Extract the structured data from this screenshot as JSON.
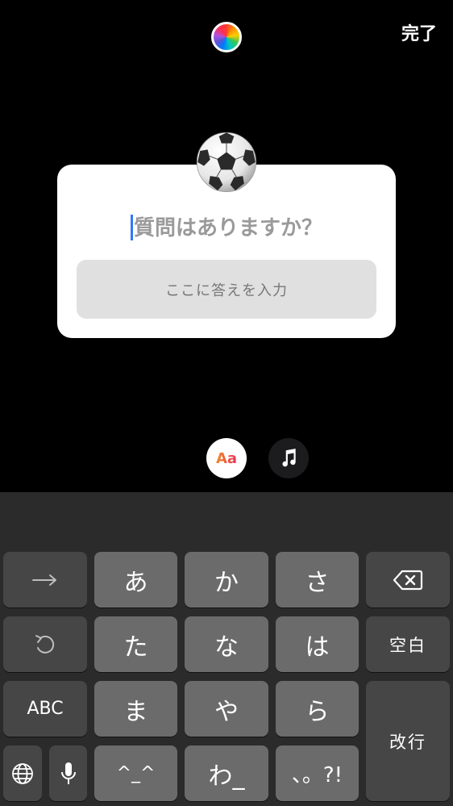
{
  "top_bar": {
    "done_label": "完了"
  },
  "sticker": {
    "question_placeholder": "質問はありますか？",
    "answer_placeholder": "ここに答えを入力",
    "emoji": "soccer-ball"
  },
  "tools": {
    "font_label": "Aa",
    "music_icon": "music-note-icon"
  },
  "keyboard": {
    "row1": [
      "→",
      "あ",
      "か",
      "さ",
      "delete-icon"
    ],
    "row2": [
      "undo-icon",
      "た",
      "な",
      "は",
      "空白"
    ],
    "row3": [
      "ABC",
      "ま",
      "や",
      "ら"
    ],
    "row4": [
      "globe-icon",
      "mic-icon",
      "^_^",
      "わ_",
      "、。?!"
    ],
    "arrow": "→",
    "a": "あ",
    "ka": "か",
    "sa": "さ",
    "ta": "た",
    "na": "な",
    "ha": "は",
    "space": "空白",
    "abc": "ABC",
    "ma": "ま",
    "ya": "や",
    "ra": "ら",
    "return": "改行",
    "emoticon": "^_^",
    "wa": "わ_",
    "punct": "、。?!"
  },
  "colors": {
    "background": "#000000",
    "keyboard": "#2b2b2b",
    "caret": "#3478f6"
  }
}
